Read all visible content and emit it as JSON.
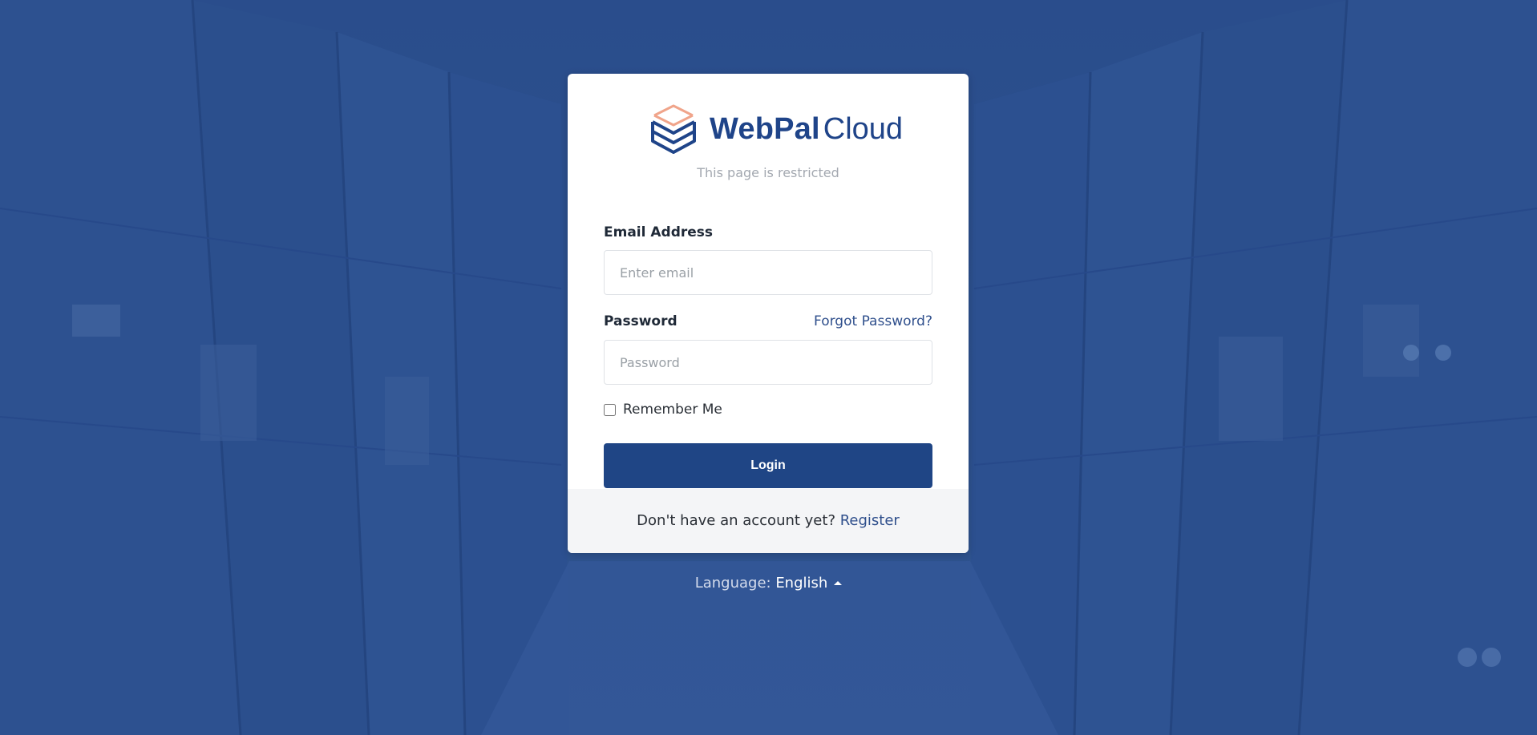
{
  "brand": {
    "name_bold": "WebPal",
    "name_light": "Cloud",
    "primary_color": "#1f4585",
    "accent_color": "#f0a48a"
  },
  "subtitle": "This page is restricted",
  "form": {
    "email_label": "Email Address",
    "email_placeholder": "Enter email",
    "email_value": "",
    "password_label": "Password",
    "password_placeholder": "Password",
    "password_value": "",
    "forgot_label": "Forgot Password?",
    "remember_label": "Remember Me",
    "remember_checked": false,
    "login_label": "Login"
  },
  "footer": {
    "prompt": "Don't have an account yet?",
    "register_label": "Register"
  },
  "language": {
    "label": "Language:",
    "value": "English",
    "icon": "caret-up-icon"
  },
  "background": {
    "description_color": "#2c4f8f"
  }
}
